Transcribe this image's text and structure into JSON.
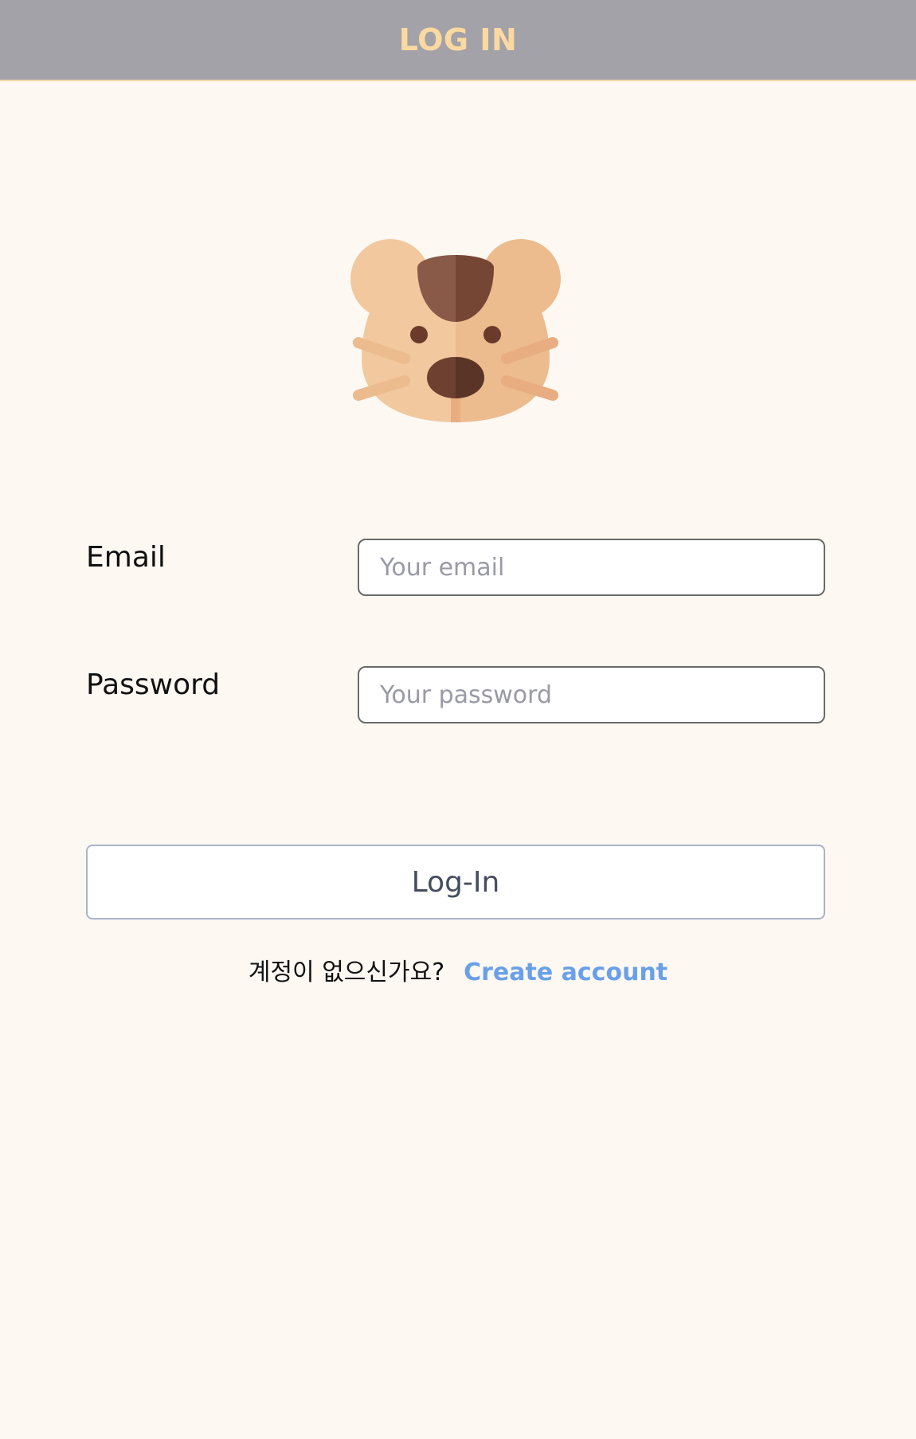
{
  "header": {
    "title": "LOG IN"
  },
  "logo": {
    "icon": "hamster-face-icon"
  },
  "form": {
    "email_label": "Email",
    "email_placeholder": "Your email",
    "email_value": "",
    "password_label": "Password",
    "password_placeholder": "Your password",
    "password_value": "",
    "submit_label": "Log-In"
  },
  "signup": {
    "prompt": "계정이 없으신가요?",
    "link_label": "Create account"
  },
  "colors": {
    "header_bg": "#a2a2a8",
    "header_text": "#fbd9a0",
    "page_bg": "#fdf8f2",
    "link": "#6aa0e8"
  }
}
